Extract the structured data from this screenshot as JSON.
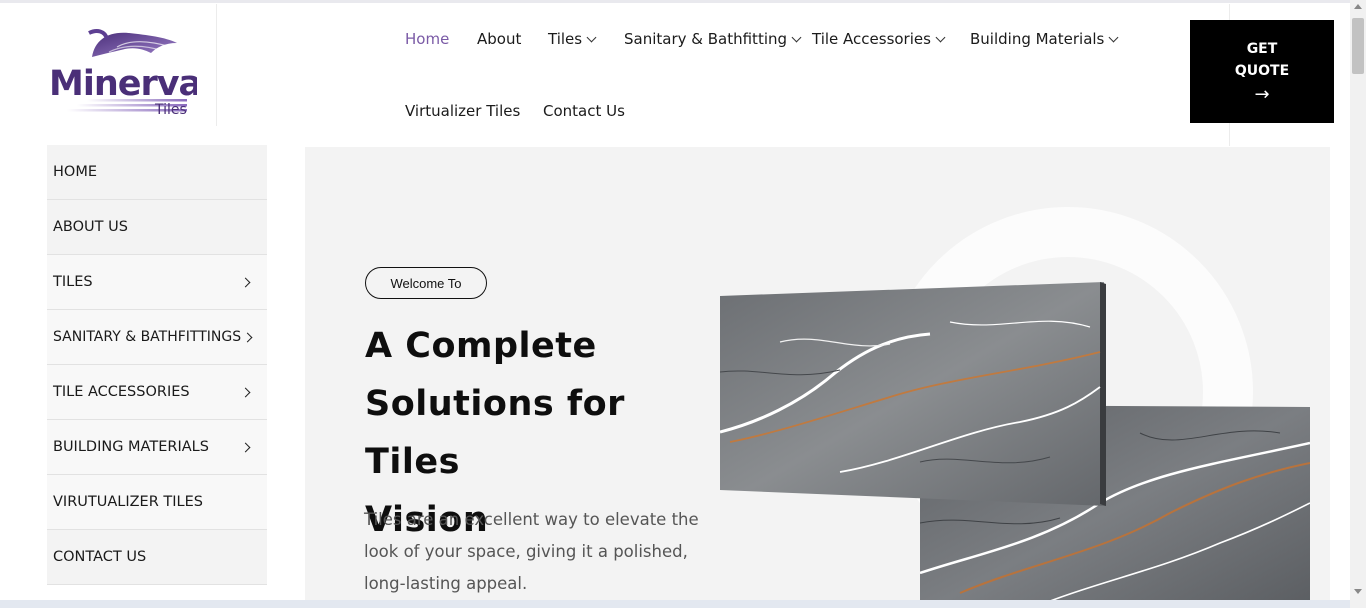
{
  "logo": {
    "brand": "Minerva",
    "sub": "Tiles"
  },
  "nav": {
    "items": [
      {
        "label": "Home",
        "active": true,
        "dropdown": false
      },
      {
        "label": "About",
        "active": false,
        "dropdown": false
      },
      {
        "label": "Tiles",
        "active": false,
        "dropdown": true
      },
      {
        "label": "Sanitary & Bathfitting",
        "active": false,
        "dropdown": true
      },
      {
        "label": "Tile Accessories",
        "active": false,
        "dropdown": true
      },
      {
        "label": "Building Materials",
        "active": false,
        "dropdown": true
      },
      {
        "label": "Virtualizer Tiles",
        "active": false,
        "dropdown": false
      },
      {
        "label": "Contact Us",
        "active": false,
        "dropdown": false
      }
    ]
  },
  "quote_button": {
    "line1": "GET",
    "line2": "QUOTE",
    "arrow": "→"
  },
  "sidebar": {
    "items": [
      {
        "label": "HOME",
        "submenu": false
      },
      {
        "label": "ABOUT US",
        "submenu": false
      },
      {
        "label": "TILES",
        "submenu": true
      },
      {
        "label": "SANITARY & BATHFITTINGS",
        "submenu": true
      },
      {
        "label": "TILE ACCESSORIES",
        "submenu": true
      },
      {
        "label": "BUILDING MATERIALS",
        "submenu": true
      },
      {
        "label": "VIRUTUALIZER TILES",
        "submenu": false
      },
      {
        "label": "CONTACT US",
        "submenu": false
      }
    ]
  },
  "hero": {
    "badge": "Welcome To",
    "headline_line1": "A Complete",
    "headline_line2": "Solutions for Tiles",
    "headline_line3": "Vision",
    "description": "Tiles are an excellent way to elevate the look of your space, giving it a polished, long-lasting appeal."
  },
  "colors": {
    "accent": "#7a5aa6",
    "button_bg": "#000000",
    "hero_bg": "#f3f3f3"
  },
  "icons": {
    "dropdown": "chevron-down-icon",
    "submenu": "chevron-right-icon",
    "quote_arrow": "arrow-right-icon"
  }
}
